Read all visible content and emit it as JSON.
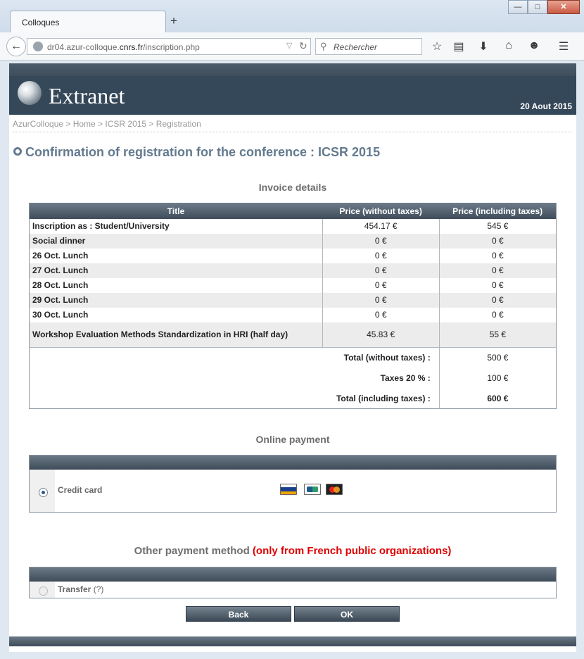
{
  "browser": {
    "tab_title": "Colloques",
    "new_tab": "+",
    "url_prefix": "dr04.azur-colloque.",
    "url_domain": "cnrs.fr",
    "url_path": "/inscription.php",
    "search_placeholder": "Rechercher",
    "window_buttons": {
      "minimize": "—",
      "maximize": "□",
      "close": "✕"
    },
    "icons": [
      "star-icon",
      "reading-list-icon",
      "download-icon",
      "home-icon",
      "emoji-icon",
      "menu-icon"
    ]
  },
  "header": {
    "logo_text": "Extranet",
    "date": "20 Aout 2015"
  },
  "breadcrumb": "AzurColloque > Home > ICSR 2015 > Registration",
  "page_title": "Confirmation of registration for the conference : ICSR 2015",
  "invoice": {
    "section_title": "Invoice details",
    "columns": [
      "Title",
      "Price (without taxes)",
      "Price (including taxes)"
    ],
    "rows": [
      {
        "title": "Inscription as : Student/University",
        "without": "454.17 €",
        "including": "545 €"
      },
      {
        "title": "Social dinner",
        "without": "0 €",
        "including": "0 €"
      },
      {
        "title": "26 Oct. Lunch",
        "without": "0 €",
        "including": "0 €"
      },
      {
        "title": "27 Oct. Lunch",
        "without": "0 €",
        "including": "0 €"
      },
      {
        "title": "28 Oct. Lunch",
        "without": "0 €",
        "including": "0 €"
      },
      {
        "title": "29 Oct. Lunch",
        "without": "0 €",
        "including": "0 €"
      },
      {
        "title": "30 Oct. Lunch",
        "without": "0 €",
        "including": "0 €"
      },
      {
        "title": "Workshop Evaluation Methods Standardization in HRI (half day)",
        "without": "45.83 €",
        "including": "55 €"
      }
    ],
    "totals": [
      {
        "label": "Total (without taxes) :",
        "value": "500 €"
      },
      {
        "label": "Taxes 20 % :",
        "value": "100 €"
      },
      {
        "label": "Total (including taxes) :",
        "value": "600 €"
      }
    ]
  },
  "online_payment": {
    "section_title": "Online payment",
    "method_label": "Credit card",
    "selected": true,
    "cards": [
      "visa-icon",
      "cb-icon",
      "mastercard-icon"
    ]
  },
  "other_payment": {
    "title_main": "Other payment method",
    "title_note": "(only from French public organizations)",
    "method_label": "Transfer",
    "help": "(?)",
    "selected": false
  },
  "buttons": {
    "back": "Back",
    "ok": "OK"
  }
}
